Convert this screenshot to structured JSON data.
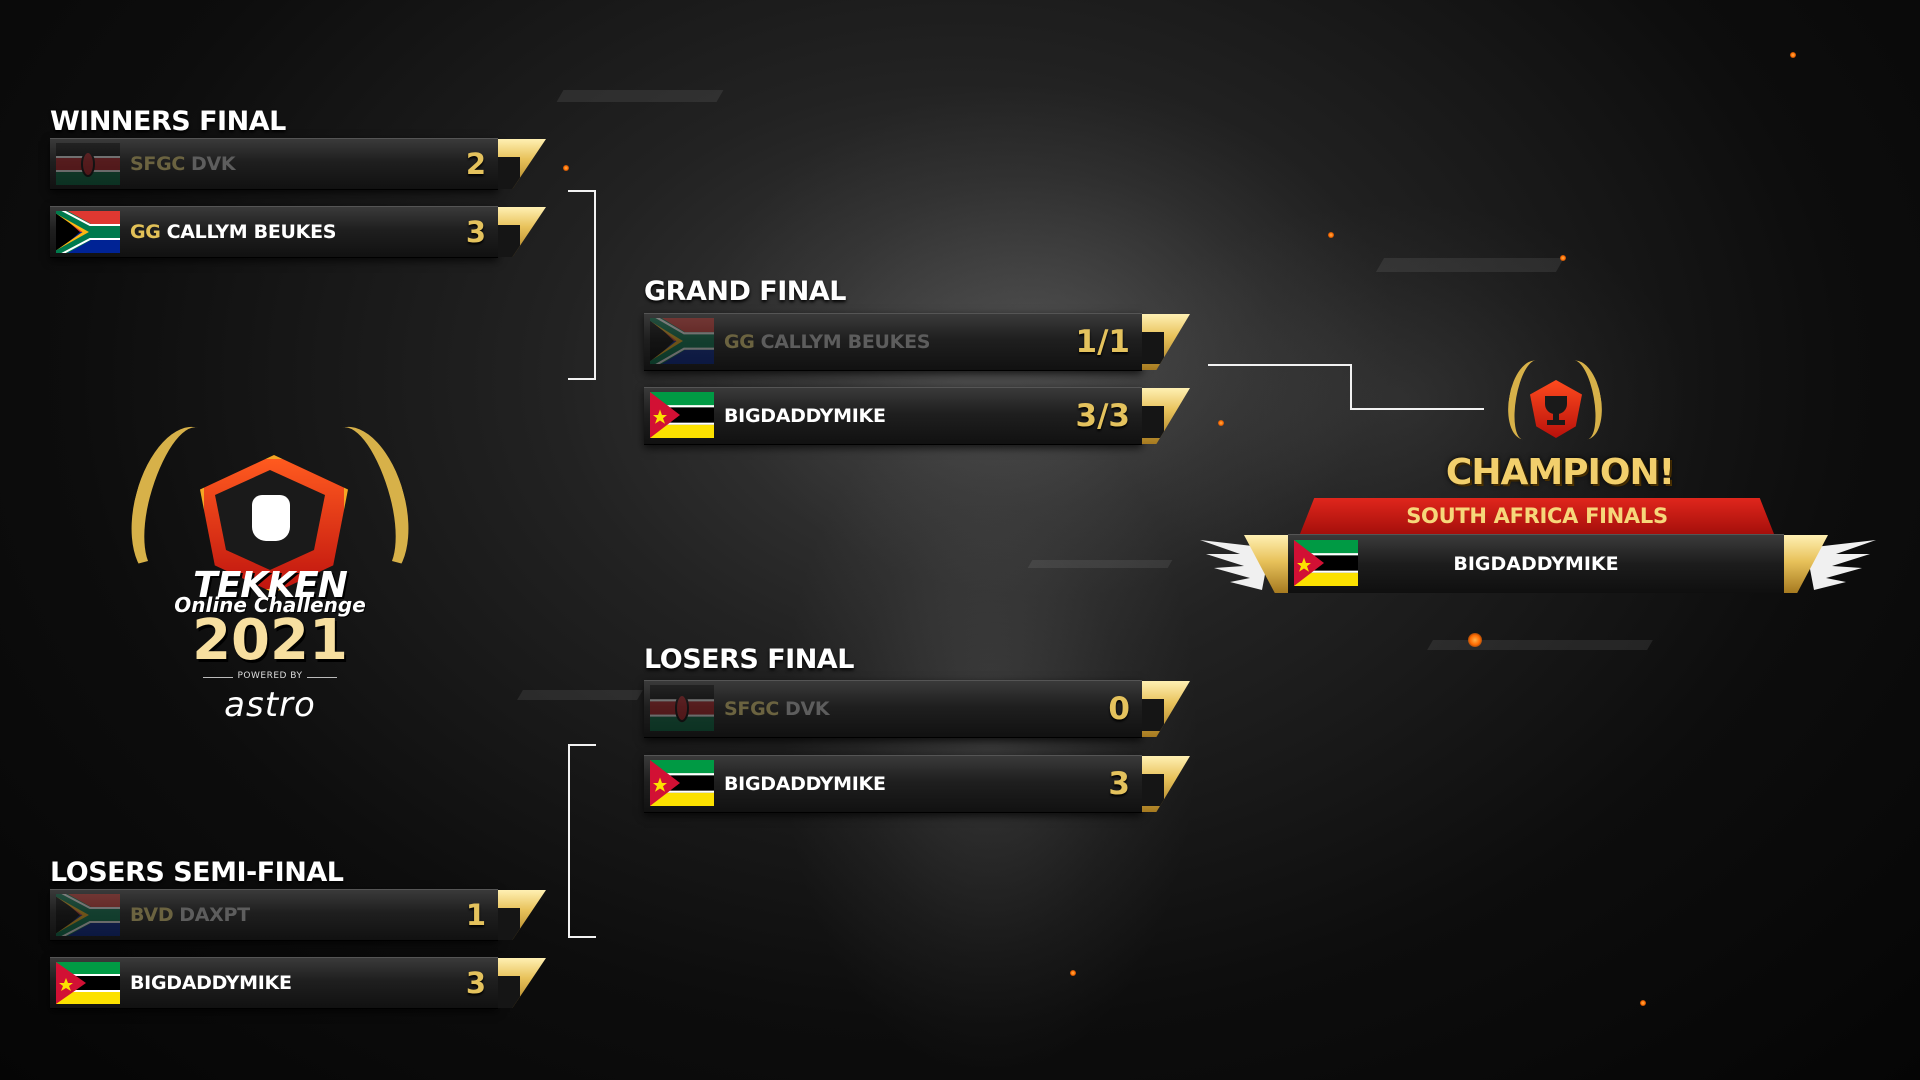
{
  "sections": {
    "winners_final": "WINNERS FINAL",
    "grand_final": "GRAND FINAL",
    "losers_final": "LOSERS FINAL",
    "losers_semi_final": "LOSERS SEMI-FINAL"
  },
  "matches": {
    "winners_final": [
      {
        "tag": "SFGC",
        "name": "DVK",
        "score": "2",
        "flag": "kenya-flag",
        "result": "lose"
      },
      {
        "tag": "GG",
        "name": "CALLYM BEUKES",
        "score": "3",
        "flag": "south-africa-flag",
        "result": "win"
      }
    ],
    "grand_final": [
      {
        "tag": "GG",
        "name": "CALLYM BEUKES",
        "score": "1/1",
        "flag": "south-africa-flag",
        "result": "lose"
      },
      {
        "tag": "",
        "name": "BIGDADDYMIKE",
        "score": "3/3",
        "flag": "mozambique-flag",
        "result": "win"
      }
    ],
    "losers_final": [
      {
        "tag": "SFGC",
        "name": "DVK",
        "score": "0",
        "flag": "kenya-flag",
        "result": "lose"
      },
      {
        "tag": "",
        "name": "BIGDADDYMIKE",
        "score": "3",
        "flag": "mozambique-flag",
        "result": "win"
      }
    ],
    "losers_semi_final": [
      {
        "tag": "BVD",
        "name": "DAXPT",
        "score": "1",
        "flag": "south-africa-flag",
        "result": "lose"
      },
      {
        "tag": "",
        "name": "BIGDADDYMIKE",
        "score": "3",
        "flag": "mozambique-flag",
        "result": "win"
      }
    ]
  },
  "logo": {
    "title": "TEKKEN",
    "subtitle": "Online Challenge",
    "year": "2021",
    "powered_by": "POWERED BY",
    "sponsor": "astro"
  },
  "champion": {
    "heading": "CHAMPION!",
    "event": "SOUTH AFRICA FINALS",
    "name": "BIGDADDYMIKE",
    "flag": "mozambique-flag"
  },
  "colors": {
    "gold": "#e4c25d",
    "banner_red": "#c81a12",
    "loser_text": "#5d5d5d",
    "winner_text": "#ffffff"
  }
}
